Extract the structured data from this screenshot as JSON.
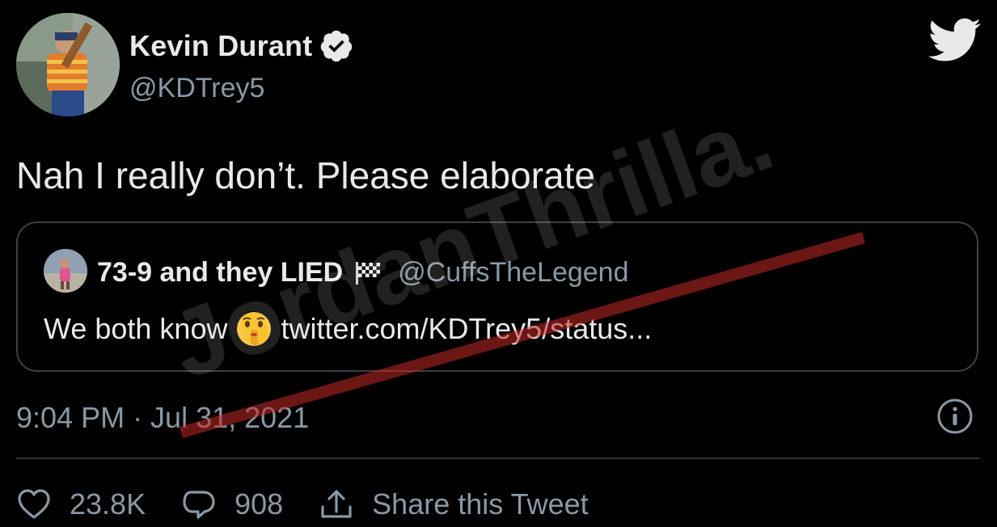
{
  "author": {
    "display_name": "Kevin Durant",
    "handle": "@KDTrey5",
    "verified": true
  },
  "tweet": {
    "text": "Nah I really don’t. Please elaborate",
    "timestamp": "9:04 PM · Jul 31, 2021"
  },
  "quoted_tweet": {
    "display_name": "73-9 and they LIED",
    "name_emoji": "chequered-flag-icon",
    "handle": "@CuffsTheLegend",
    "text": "We both know",
    "text_emoji": "shushing-face-icon",
    "link": "twitter.com/KDTrey5/status..."
  },
  "actions": {
    "likes": "23.8K",
    "replies": "908",
    "share_label": "Share this Tweet"
  },
  "watermark": {
    "text": "JordanThrilla."
  },
  "colors": {
    "background": "#000000",
    "text_primary": "#e7e9ea",
    "text_secondary": "#8b98a5",
    "border": "#3d4046",
    "watermark_stripe": "#c62828"
  },
  "icons": {
    "brand": "twitter-bird-icon",
    "verified": "verified-badge-icon",
    "info": "info-icon",
    "like": "heart-icon",
    "reply": "reply-bubble-icon",
    "share": "share-icon"
  }
}
